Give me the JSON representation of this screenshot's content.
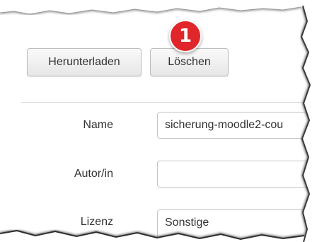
{
  "toolbar": {
    "download_label": "Herunterladen",
    "delete_label": "Löschen"
  },
  "callout": {
    "number": "1",
    "color": "#e0262a"
  },
  "form": {
    "name_label": "Name",
    "name_value": "sicherung-moodle2-cou",
    "author_label": "Autor/in",
    "author_value": "",
    "license_label": "Lizenz",
    "license_value": "Sonstige"
  }
}
